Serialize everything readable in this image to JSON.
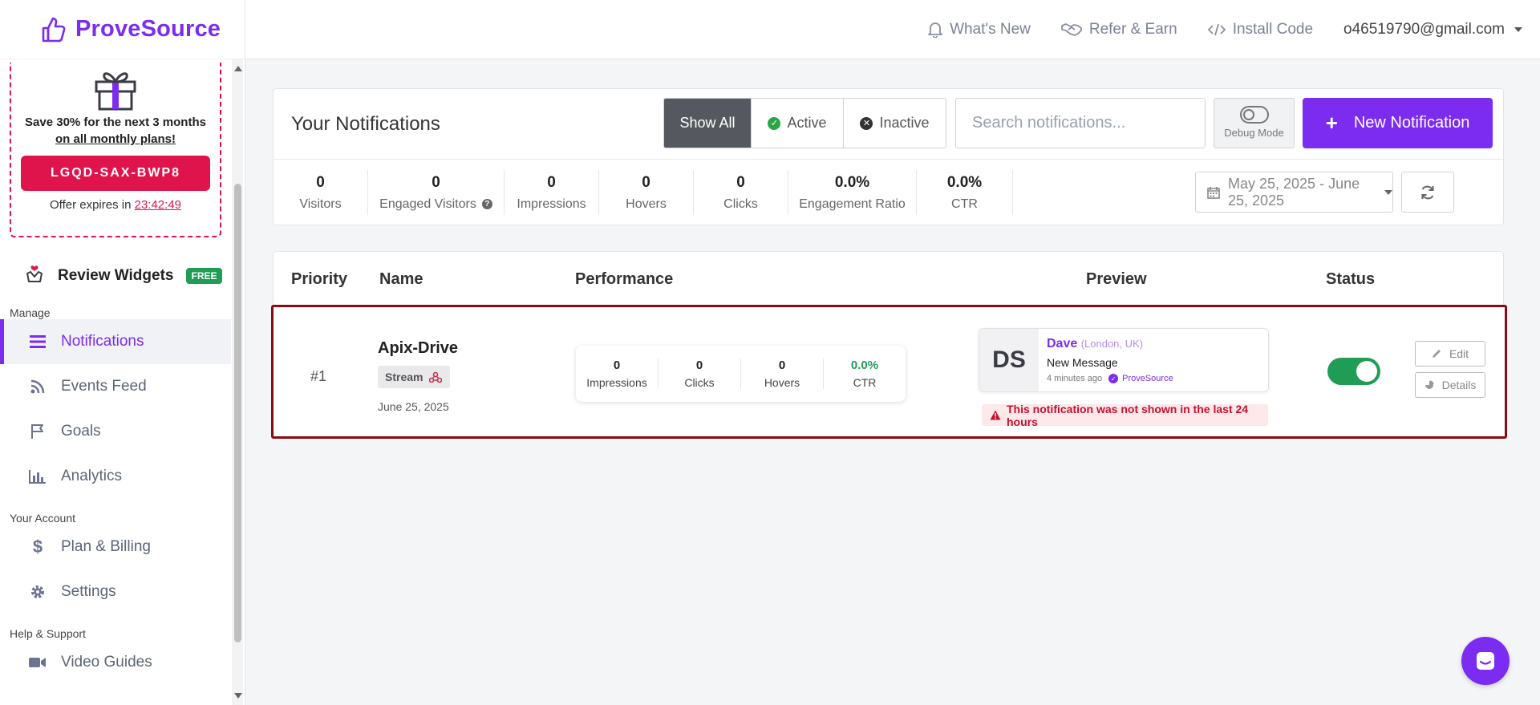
{
  "brand": {
    "name": "ProveSource",
    "color": "#7b2cf0"
  },
  "promo": {
    "line1": "Save 30% for the next 3 months",
    "line2": "on all monthly plans!",
    "code": "LGQD-SAX-BWP8",
    "expires_prefix": "Offer expires in ",
    "timer": "23:42:49"
  },
  "review_widgets": {
    "label": "Review Widgets",
    "badge": "FREE"
  },
  "sidebar": {
    "manage_label": "Manage",
    "manage_items": [
      {
        "label": "Notifications",
        "icon": "bars-icon",
        "active": true
      },
      {
        "label": "Events Feed",
        "icon": "rss-icon"
      },
      {
        "label": "Goals",
        "icon": "flag-icon"
      },
      {
        "label": "Analytics",
        "icon": "bar-chart-icon"
      }
    ],
    "account_label": "Your Account",
    "account_items": [
      {
        "label": "Plan & Billing",
        "icon": "dollar-icon"
      },
      {
        "label": "Settings",
        "icon": "gear-icon"
      }
    ],
    "help_label": "Help & Support",
    "help_items": [
      {
        "label": "Video Guides",
        "icon": "video-icon"
      }
    ]
  },
  "topbar": {
    "whats_new": "What's New",
    "refer": "Refer & Earn",
    "install": "Install Code",
    "user": "o46519790@gmail.com"
  },
  "notifications": {
    "title": "Your Notifications",
    "filters": {
      "all": "Show All",
      "active": "Active",
      "inactive": "Inactive",
      "selected": "Show All"
    },
    "search_placeholder": "Search notifications...",
    "debug_label": "Debug Mode",
    "new_label": "New Notification",
    "stats": [
      {
        "value": "0",
        "label": "Visitors"
      },
      {
        "value": "0",
        "label": "Engaged Visitors"
      },
      {
        "value": "0",
        "label": "Impressions"
      },
      {
        "value": "0",
        "label": "Hovers"
      },
      {
        "value": "0",
        "label": "Clicks"
      },
      {
        "value": "0.0%",
        "label": "Engagement Ratio"
      },
      {
        "value": "0.0%",
        "label": "CTR"
      }
    ],
    "date_range": "May 25, 2025 - June 25, 2025"
  },
  "table": {
    "headers": {
      "priority": "Priority",
      "name": "Name",
      "performance": "Performance",
      "preview": "Preview",
      "status": "Status"
    },
    "row": {
      "priority": "#1",
      "name": "Apix-Drive",
      "type": "Stream",
      "date": "June 25, 2025",
      "perf": [
        {
          "value": "0",
          "label": "Impressions"
        },
        {
          "value": "0",
          "label": "Clicks"
        },
        {
          "value": "0",
          "label": "Hovers"
        },
        {
          "value": "0.0%",
          "label": "CTR"
        }
      ],
      "preview": {
        "initials": "DS",
        "name": "Dave",
        "location": "(London, UK)",
        "message": "New Message",
        "time": "4 minutes ago",
        "brand": "ProveSource"
      },
      "warning": "This notification was not shown in the last 24 hours",
      "status_on": true,
      "edit_label": "Edit",
      "details_label": "Details"
    }
  }
}
